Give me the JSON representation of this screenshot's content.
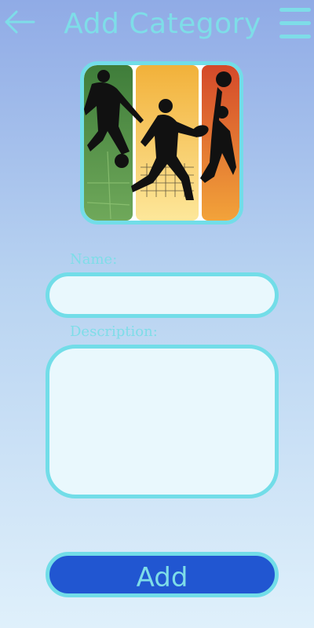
{
  "header": {
    "title": "Add Category",
    "back_icon": "arrow-left-icon",
    "menu_icon": "hamburger-menu-icon"
  },
  "category_image": {
    "description_icon": "sports-collage-image"
  },
  "form": {
    "name_label": "Name:",
    "name_value": "",
    "description_label": "Description:",
    "description_value": ""
  },
  "actions": {
    "add_label": "Add"
  },
  "colors": {
    "accent": "#72dde8",
    "button": "#2156d1",
    "background_top": "#90abe6",
    "background_bottom": "#dff0fb",
    "field_fill": "#e9f8fd"
  }
}
